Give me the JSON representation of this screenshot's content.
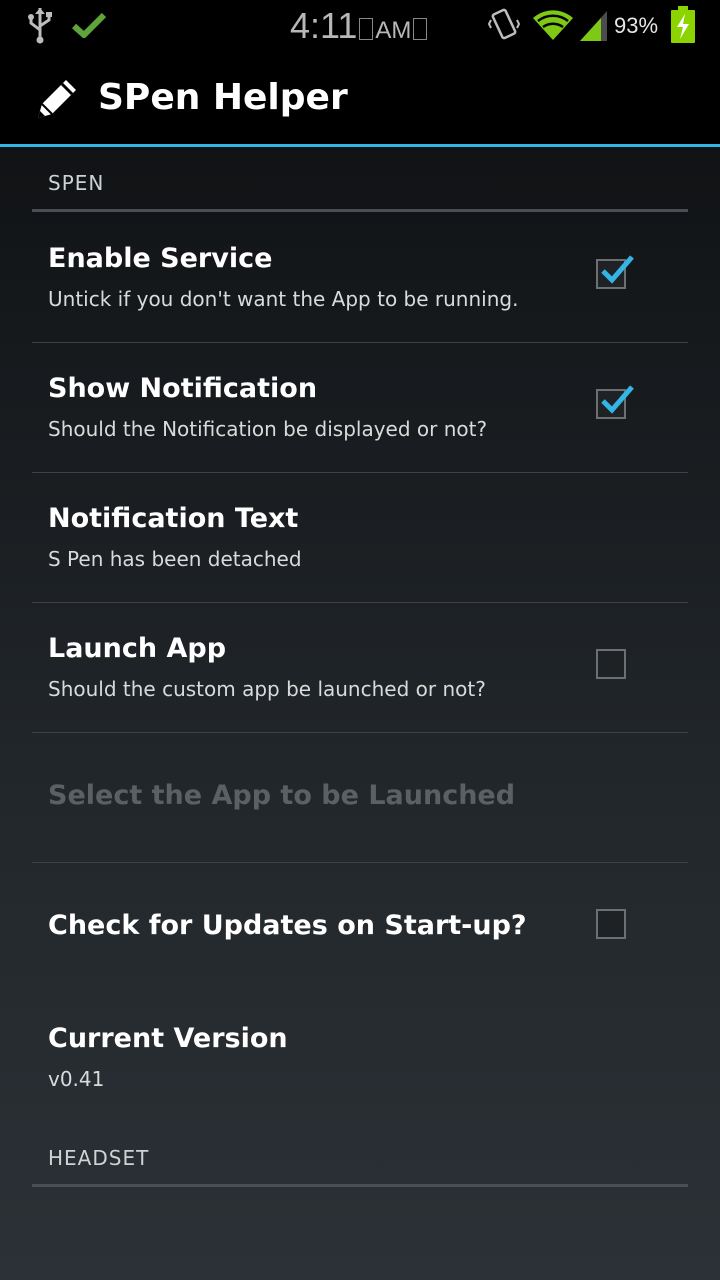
{
  "status_bar": {
    "time": "4:11",
    "ampm": "AM",
    "battery": "93%",
    "icons": [
      "usb-icon",
      "check-icon",
      "vibrate-icon",
      "wifi-icon",
      "signal-icon",
      "battery-charging-icon"
    ]
  },
  "action_bar": {
    "icon": "pencil-icon",
    "title": "SPen Helper"
  },
  "sections": {
    "spen": {
      "header": "SPEN",
      "enable_service": {
        "title": "Enable Service",
        "summary": "Untick if you don't want the App to be running.",
        "checked": true
      },
      "show_notification": {
        "title": "Show Notification",
        "summary": "Should the Notification be displayed or not?",
        "checked": true
      },
      "notification_text": {
        "title": "Notification Text",
        "summary": "S Pen has been detached"
      },
      "launch_app": {
        "title": "Launch App",
        "summary": "Should the custom app be launched or not?",
        "checked": false
      },
      "select_app": {
        "title": "Select the App to be Launched",
        "enabled": false
      },
      "check_updates": {
        "title": "Check for Updates on Start-up?",
        "checked": false
      },
      "current_version": {
        "title": "Current Version",
        "summary": "v0.41"
      }
    },
    "headset": {
      "header": "HEADSET"
    }
  },
  "colors": {
    "accent": "#33b5e5",
    "battery_green": "#8bd400",
    "wifi_green": "#7ec914"
  }
}
